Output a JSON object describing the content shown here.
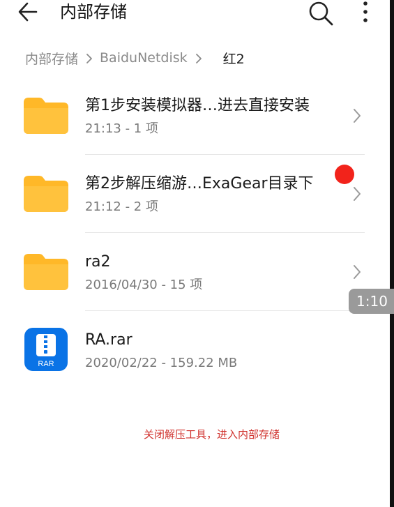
{
  "header": {
    "title": "内部存储",
    "back_icon": "arrow-left-icon",
    "search_icon": "search-icon",
    "more_icon": "more-vertical-icon"
  },
  "breadcrumb": {
    "items": [
      "内部存储",
      "BaiduNetdisk"
    ],
    "current": "红2"
  },
  "files": [
    {
      "name": "第1步安装模拟器…进去直接安装",
      "meta": "21:13 - 1 项",
      "type": "folder",
      "icon": "folder-icon"
    },
    {
      "name": "第2步解压缩游…ExaGear目录下",
      "meta": "21:12 - 2 项",
      "type": "folder",
      "icon": "folder-icon"
    },
    {
      "name": "ra2",
      "meta": "2016/04/30 - 15 项",
      "type": "folder",
      "icon": "folder-icon"
    },
    {
      "name": "RA.rar",
      "meta": "2020/02/22 - 159.22 MB",
      "type": "archive",
      "icon": "rar-archive-icon",
      "icon_label": "RAR"
    }
  ],
  "overlay": {
    "timestamp": "1:10",
    "caption": "关闭解压工具，进入内部存储"
  },
  "colors": {
    "folder": "#FFB828",
    "rar_icon": "#0A73E6",
    "red_dot": "#F2231B",
    "caption": "#D0312D"
  }
}
